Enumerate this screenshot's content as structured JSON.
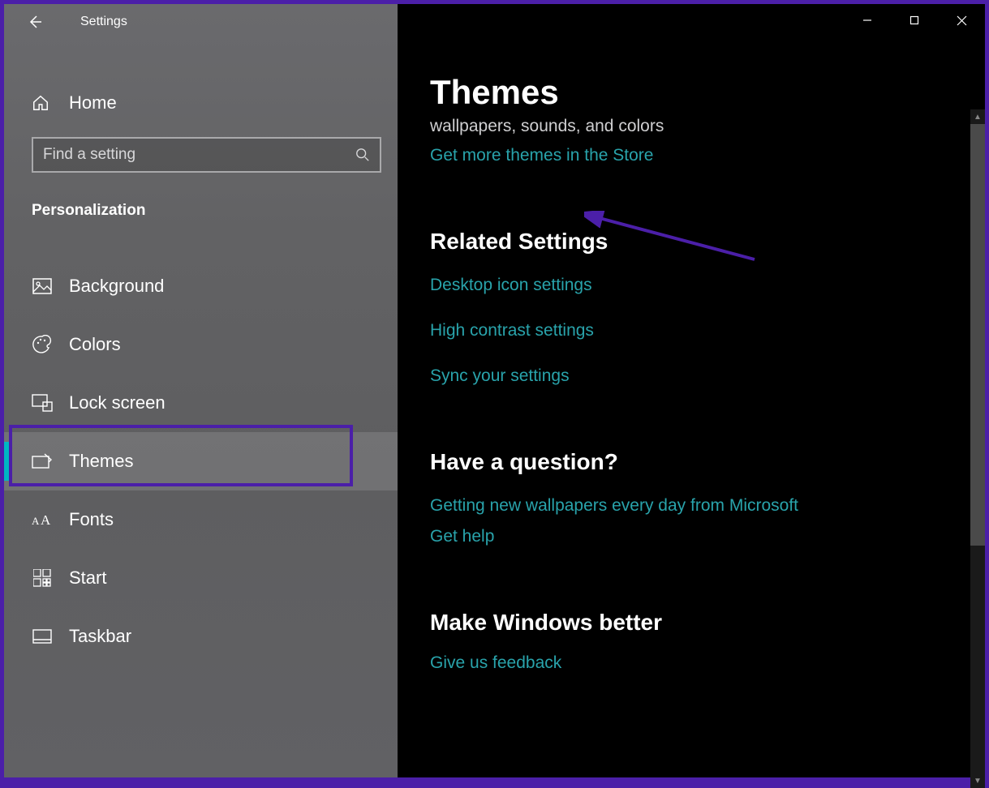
{
  "window": {
    "title": "Settings"
  },
  "sidebar": {
    "home_label": "Home",
    "search_placeholder": "Find a setting",
    "category": "Personalization",
    "items": [
      {
        "label": "Background",
        "icon": "picture-icon",
        "selected": false
      },
      {
        "label": "Colors",
        "icon": "palette-icon",
        "selected": false
      },
      {
        "label": "Lock screen",
        "icon": "lockscreen-icon",
        "selected": false
      },
      {
        "label": "Themes",
        "icon": "themes-icon",
        "selected": true
      },
      {
        "label": "Fonts",
        "icon": "fonts-icon",
        "selected": false
      },
      {
        "label": "Start",
        "icon": "start-icon",
        "selected": false
      },
      {
        "label": "Taskbar",
        "icon": "taskbar-icon",
        "selected": false
      }
    ]
  },
  "main": {
    "title": "Themes",
    "subtitle": "wallpapers, sounds, and colors",
    "store_link": "Get more themes in the Store",
    "related_heading": "Related Settings",
    "related_links": [
      "Desktop icon settings",
      "High contrast settings",
      "Sync your settings"
    ],
    "question_heading": "Have a question?",
    "question_links": [
      "Getting new wallpapers every day from Microsoft",
      "Get help"
    ],
    "better_heading": "Make Windows better",
    "better_link": "Give us feedback"
  },
  "annotation": {
    "color": "#4b1fa8"
  }
}
